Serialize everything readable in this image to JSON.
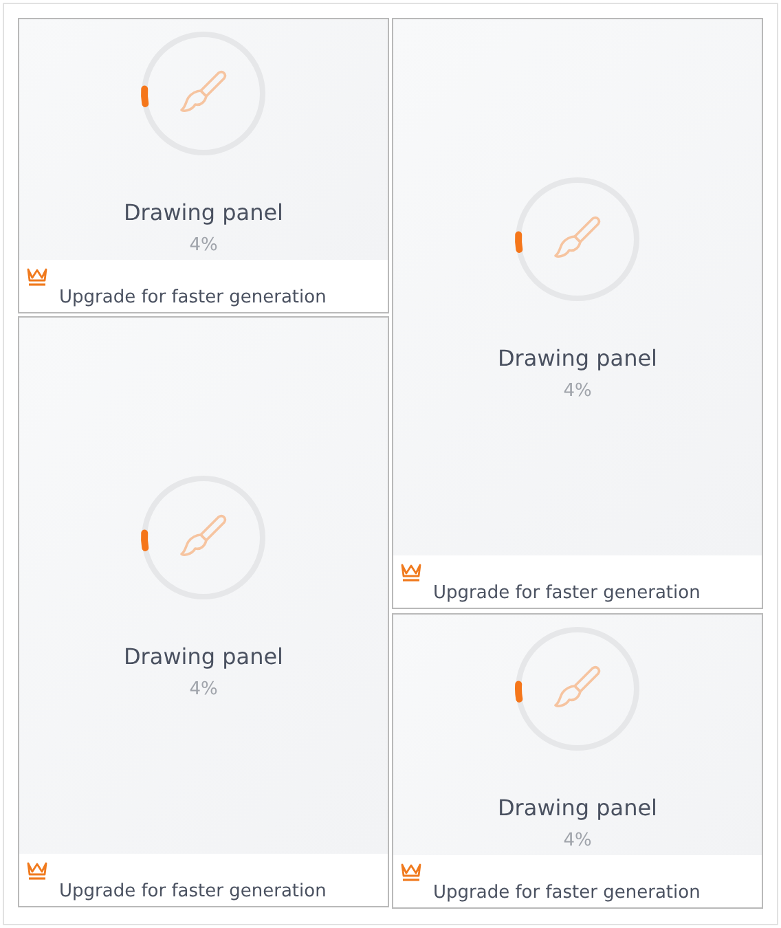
{
  "columns": [
    {
      "cards": [
        {
          "kind": "compact",
          "title": "Drawing panel",
          "percent": "4%",
          "level": 0.04,
          "footer": "Upgrade for faster generation"
        },
        {
          "kind": "tall",
          "title": "Drawing panel",
          "percent": "4%",
          "level": 0.04,
          "footer": "Upgrade for faster generation"
        }
      ]
    },
    {
      "cards": [
        {
          "kind": "tall",
          "title": "Drawing panel",
          "percent": "4%",
          "level": 0.04,
          "footer": "Upgrade for faster generation"
        },
        {
          "kind": "compact",
          "title": "Drawing panel",
          "percent": "4%",
          "level": 0.04,
          "footer": "Upgrade for faster generation"
        }
      ]
    }
  ]
}
